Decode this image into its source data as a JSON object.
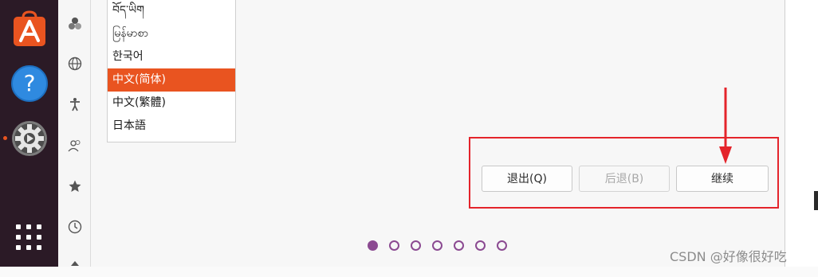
{
  "dock": {
    "items": [
      {
        "name": "software-store-icon"
      },
      {
        "name": "help-icon"
      },
      {
        "name": "settings-icon",
        "running": true
      }
    ],
    "apps_button": "show-applications-icon"
  },
  "sidebar": {
    "icons": [
      "appearance-icon",
      "region-language-icon",
      "accessibility-icon",
      "users-icon",
      "favorites-icon",
      "date-time-icon",
      "more-icon"
    ]
  },
  "language_list": {
    "items": [
      {
        "label": "བོད་ཡིག",
        "selected": false
      },
      {
        "label": "မြန်မာစာ",
        "selected": false
      },
      {
        "label": "한국어",
        "selected": false
      },
      {
        "label": "中文(简体)",
        "selected": true
      },
      {
        "label": "中文(繁體)",
        "selected": false
      },
      {
        "label": "日本語",
        "selected": false
      }
    ]
  },
  "buttons": {
    "quit": "退出(Q)",
    "back": "后退(B)",
    "continue": "继续"
  },
  "pagination": {
    "total": 7,
    "current": 1
  },
  "annotation": {
    "box_color": "#e4242b",
    "arrow_color": "#e4242b"
  },
  "colors": {
    "accent": "#e95420",
    "dot": "#8b4a91",
    "dock": "#2b1a26"
  },
  "watermark": "CSDN @好像很好吃"
}
